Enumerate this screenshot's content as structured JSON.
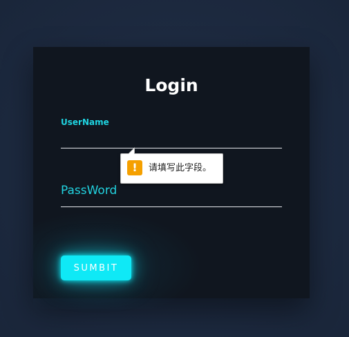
{
  "login": {
    "title": "Login",
    "username": {
      "label": "UserName",
      "value": ""
    },
    "password": {
      "label": "PassWord",
      "value": ""
    },
    "submit_label": "SUMBIT"
  },
  "validation_tooltip": {
    "icon": "warning-icon",
    "message": "请填写此字段。"
  },
  "colors": {
    "page_background": "#1d2a40",
    "card_background": "#10161f",
    "accent": "#0fe9f6",
    "label": "#22d3e0",
    "warning": "#f5a000"
  }
}
